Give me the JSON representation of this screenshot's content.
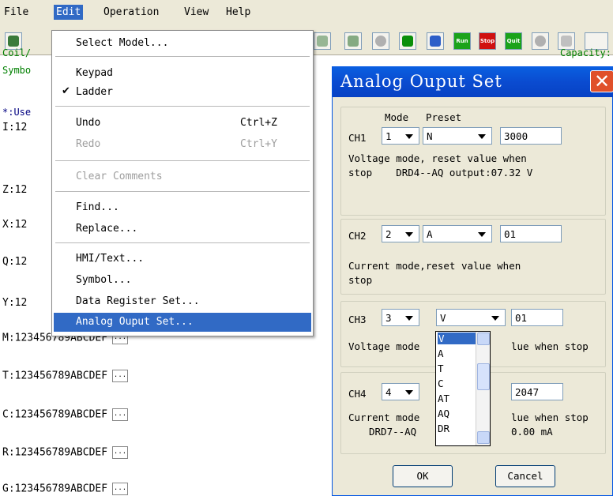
{
  "menubar": {
    "file": "File",
    "edit": "Edit",
    "operation": "Operation",
    "view": "View",
    "help": "Help"
  },
  "toolbar": {
    "run": "Run",
    "stop": "Stop",
    "quit": "Quit"
  },
  "editor": {
    "capacity": "Capacity:",
    "coil_label": "Coil/",
    "symbol_label": "Symbo",
    "use_label": "*:Use",
    "rows": [
      "I:12",
      "Z:12",
      "X:12",
      "Q:12",
      "Y:12"
    ],
    "full_rows": [
      "M:123456789ABCDEF",
      "T:123456789ABCDEF",
      "C:123456789ABCDEF",
      "R:123456789ABCDEF",
      "G:123456789ABCDEF"
    ],
    "dots_label": "..."
  },
  "edit_menu": {
    "select_model": "Select Model...",
    "keypad": "Keypad",
    "ladder": "Ladder",
    "undo": "Undo",
    "undo_sc": "Ctrl+Z",
    "redo": "Redo",
    "redo_sc": "Ctrl+Y",
    "clear_comments": "Clear Comments",
    "find": "Find...",
    "replace": "Replace...",
    "hmi_text": "HMI/Text...",
    "symbol": "Symbol...",
    "data_register": "Data Register Set...",
    "analog_output": "Analog Ouput Set..."
  },
  "dialog": {
    "title": "Analog Ouput Set",
    "mode_header": "Mode",
    "preset_header": "Preset",
    "ch1": {
      "label": "CH1",
      "mode": "1",
      "preset": "N",
      "value": "3000",
      "desc1": "Voltage mode, reset value when",
      "desc2": "stop    DRD4--AQ output:07.32 V"
    },
    "ch2": {
      "label": "CH2",
      "mode": "2",
      "preset": "A",
      "value": "01",
      "desc1": "Current mode,reset value when",
      "desc2": "stop"
    },
    "ch3": {
      "label": "CH3",
      "mode": "3",
      "preset": "V",
      "value": "01",
      "desc_left": "Voltage mode",
      "desc_right": "lue when stop"
    },
    "ch4": {
      "label": "CH4",
      "mode": "4",
      "value": "2047",
      "desc_left": "Current mode",
      "desc_right": "lue when stop",
      "desc2_left": "DRD7--AQ",
      "desc2_right": "0.00 mA"
    },
    "ok": "OK",
    "cancel": "Cancel",
    "preset_options": [
      "V",
      "A",
      "T",
      "C",
      "AT",
      "AQ",
      "DR"
    ]
  },
  "colors": {
    "menu_highlight": "#316ac5",
    "title_bar": "#0a4bd0",
    "comment_green": "#008000"
  }
}
